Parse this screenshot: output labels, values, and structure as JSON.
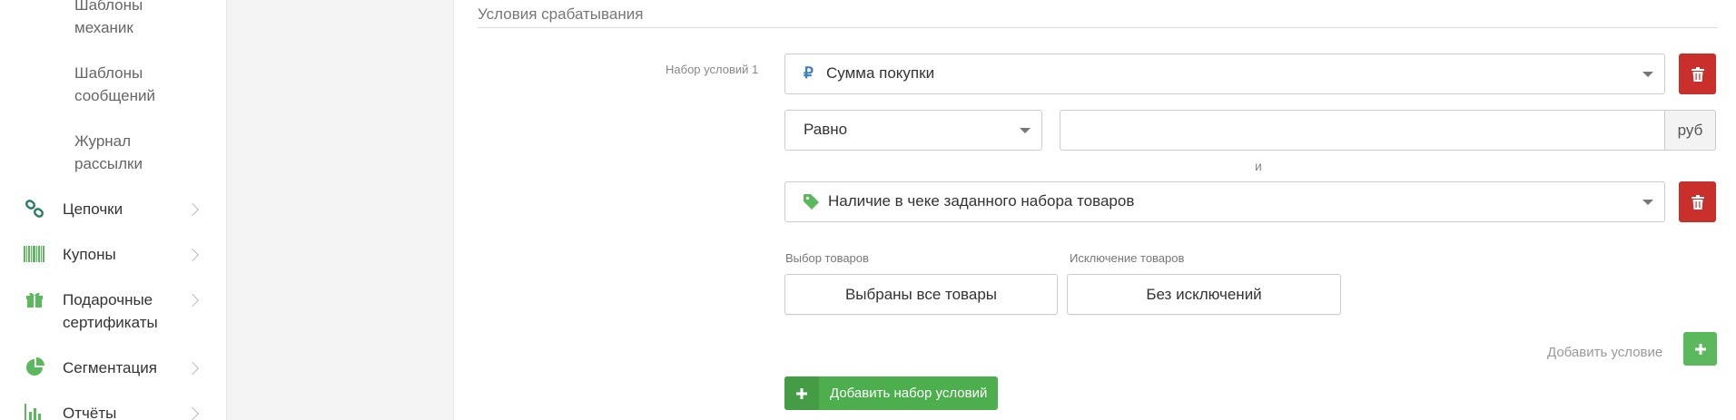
{
  "sidebar": {
    "sub_items": [
      {
        "label": "Шаблоны механик"
      },
      {
        "label": "Шаблоны сообщений"
      },
      {
        "label": "Журнал рассылки"
      }
    ],
    "items": [
      {
        "label": "Цепочки",
        "icon": "chain-icon"
      },
      {
        "label": "Купоны",
        "icon": "barcode-icon"
      },
      {
        "label": "Подарочные сертификаты",
        "icon": "gift-icon"
      },
      {
        "label": "Сегментация",
        "icon": "pie-chart-icon"
      },
      {
        "label": "Отчёты",
        "icon": "bar-chart-icon"
      }
    ]
  },
  "main": {
    "section_title": "Условия срабатывания",
    "condition_set_label": "Набор условий 1",
    "condition1": {
      "icon": "ruble-icon",
      "value": "Сумма покупки"
    },
    "operator": {
      "value": "Равно"
    },
    "amount": {
      "value": "",
      "unit": "руб"
    },
    "and_text": "и",
    "condition2": {
      "icon": "tag-icon",
      "value": "Наличие в чеке заданного набора товаров"
    },
    "product_pick": {
      "label": "Выбор товаров",
      "button": "Выбраны все товары"
    },
    "product_exclude": {
      "label": "Исключение товаров",
      "button": "Без исключений"
    },
    "add_condition_label": "Добавить условие",
    "add_set_label": "Добавить набор условий"
  },
  "colors": {
    "green": "#5cb85c",
    "red": "#c9302c",
    "icon_blue": "#3a7fc1"
  }
}
